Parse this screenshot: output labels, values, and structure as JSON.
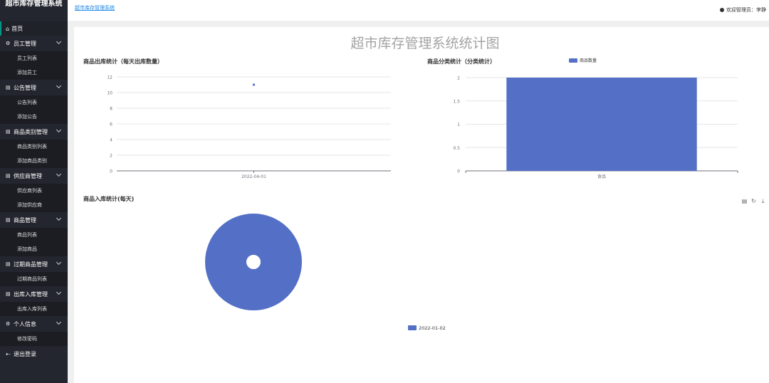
{
  "app": {
    "title": "超市库存管理系统"
  },
  "sidebar": {
    "home": {
      "icon": "home-icon",
      "label": "首页"
    },
    "groups": [
      {
        "icon": "gear-icon",
        "label": "员工管理",
        "items": [
          "员工列表",
          "添加员工"
        ]
      },
      {
        "icon": "document-icon",
        "label": "公告管理",
        "items": [
          "公告列表",
          "添加公告"
        ]
      },
      {
        "icon": "document-icon",
        "label": "商品类别管理",
        "items": [
          "商品类别列表",
          "添加商品类别"
        ]
      },
      {
        "icon": "document-icon",
        "label": "供应商管理",
        "items": [
          "供应商列表",
          "添加供应商"
        ]
      },
      {
        "icon": "document-icon",
        "label": "商品管理",
        "items": [
          "商品列表",
          "添加商品"
        ]
      },
      {
        "icon": "document-icon",
        "label": "过期商品管理",
        "items": [
          "过期商品列表"
        ]
      },
      {
        "icon": "document-icon",
        "label": "出库入库管理",
        "items": [
          "出库入库列表"
        ]
      },
      {
        "icon": "gear-icon",
        "label": "个人信息",
        "items": [
          "修改密码"
        ]
      }
    ],
    "logout": {
      "icon": "logout-icon",
      "label": "退出登录"
    }
  },
  "header": {
    "breadcrumb": "超市库存管理系统",
    "welcome": "欢迎管理员：李静"
  },
  "main": {
    "page_title": "超市库存管理系统统计图"
  },
  "chart_data": [
    {
      "type": "scatter",
      "title": "商品出库统计（每天出库数量）",
      "categories": [
        "2022-04-01"
      ],
      "series": [
        {
          "values": [
            11
          ]
        }
      ],
      "ylim": [
        0,
        12
      ],
      "yticks": [
        0,
        2,
        4,
        6,
        8,
        10,
        12
      ],
      "grid": true,
      "color": "#5470c6"
    },
    {
      "type": "bar",
      "title": "商品分类统计（分类统计）",
      "categories": [
        "食品"
      ],
      "series": [
        {
          "name": "商品数量",
          "values": [
            2
          ]
        }
      ],
      "ylim": [
        0,
        2
      ],
      "yticks": [
        "0",
        "0.5",
        "1",
        "1.5",
        "2"
      ],
      "grid": true,
      "legend": "top-center",
      "color": "#5470c6"
    },
    {
      "type": "pie",
      "title": "商品入库统计(每天)",
      "slices": [
        {
          "label": "2022-01-02",
          "value": 1
        }
      ],
      "legend": "bottom-center",
      "color": "#5470c6"
    }
  ],
  "toolbox": {
    "icons": [
      "data-view-icon",
      "refresh-icon",
      "download-icon"
    ],
    "glyphs": [
      "▤",
      "↻",
      "⤓"
    ]
  }
}
